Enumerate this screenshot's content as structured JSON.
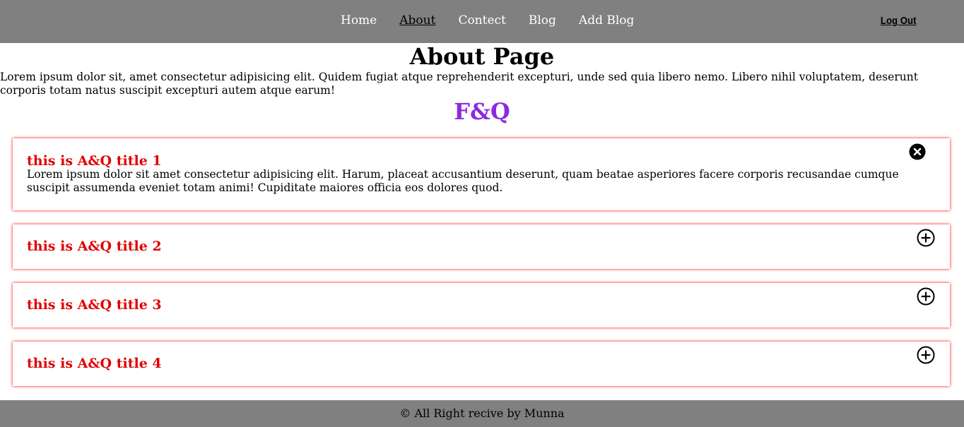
{
  "nav": {
    "links": [
      "Home",
      "About",
      "Contect",
      "Blog",
      "Add Blog"
    ],
    "active": "About",
    "logout": "Log Out"
  },
  "page": {
    "title": "About Page",
    "intro": "Lorem ipsum dolor sit, amet consectetur adipisicing elit. Quidem fugiat atque reprehenderit excepturi, unde sed quia libero nemo. Libero nihil voluptatem, deserunt corporis totam natus suscipit excepturi autem atque earum!",
    "faq_heading": "F&Q"
  },
  "faqs": [
    {
      "title": "this is A&Q title 1",
      "body": "Lorem ipsum dolor sit amet consectetur adipisicing elit. Harum, placeat accusantium deserunt, quam beatae asperiores facere corporis recusandae cumque suscipit assumenda eveniet totam animi! Cupiditate maiores officia eos dolores quod.",
      "expanded": true,
      "icon": "close-circle-icon"
    },
    {
      "title": "this is A&Q title 2",
      "expanded": false,
      "icon": "plus-circle-icon"
    },
    {
      "title": "this is A&Q title 3",
      "expanded": false,
      "icon": "plus-circle-icon"
    },
    {
      "title": "this is A&Q title 4",
      "expanded": false,
      "icon": "plus-circle-icon"
    }
  ],
  "footer": {
    "text": "© All Right recive by Munna"
  },
  "colors": {
    "navbar_bg": "#808080",
    "faq_title": "#e00000",
    "faq_heading": "#8a2be2",
    "card_shadow": "#ff0000"
  }
}
